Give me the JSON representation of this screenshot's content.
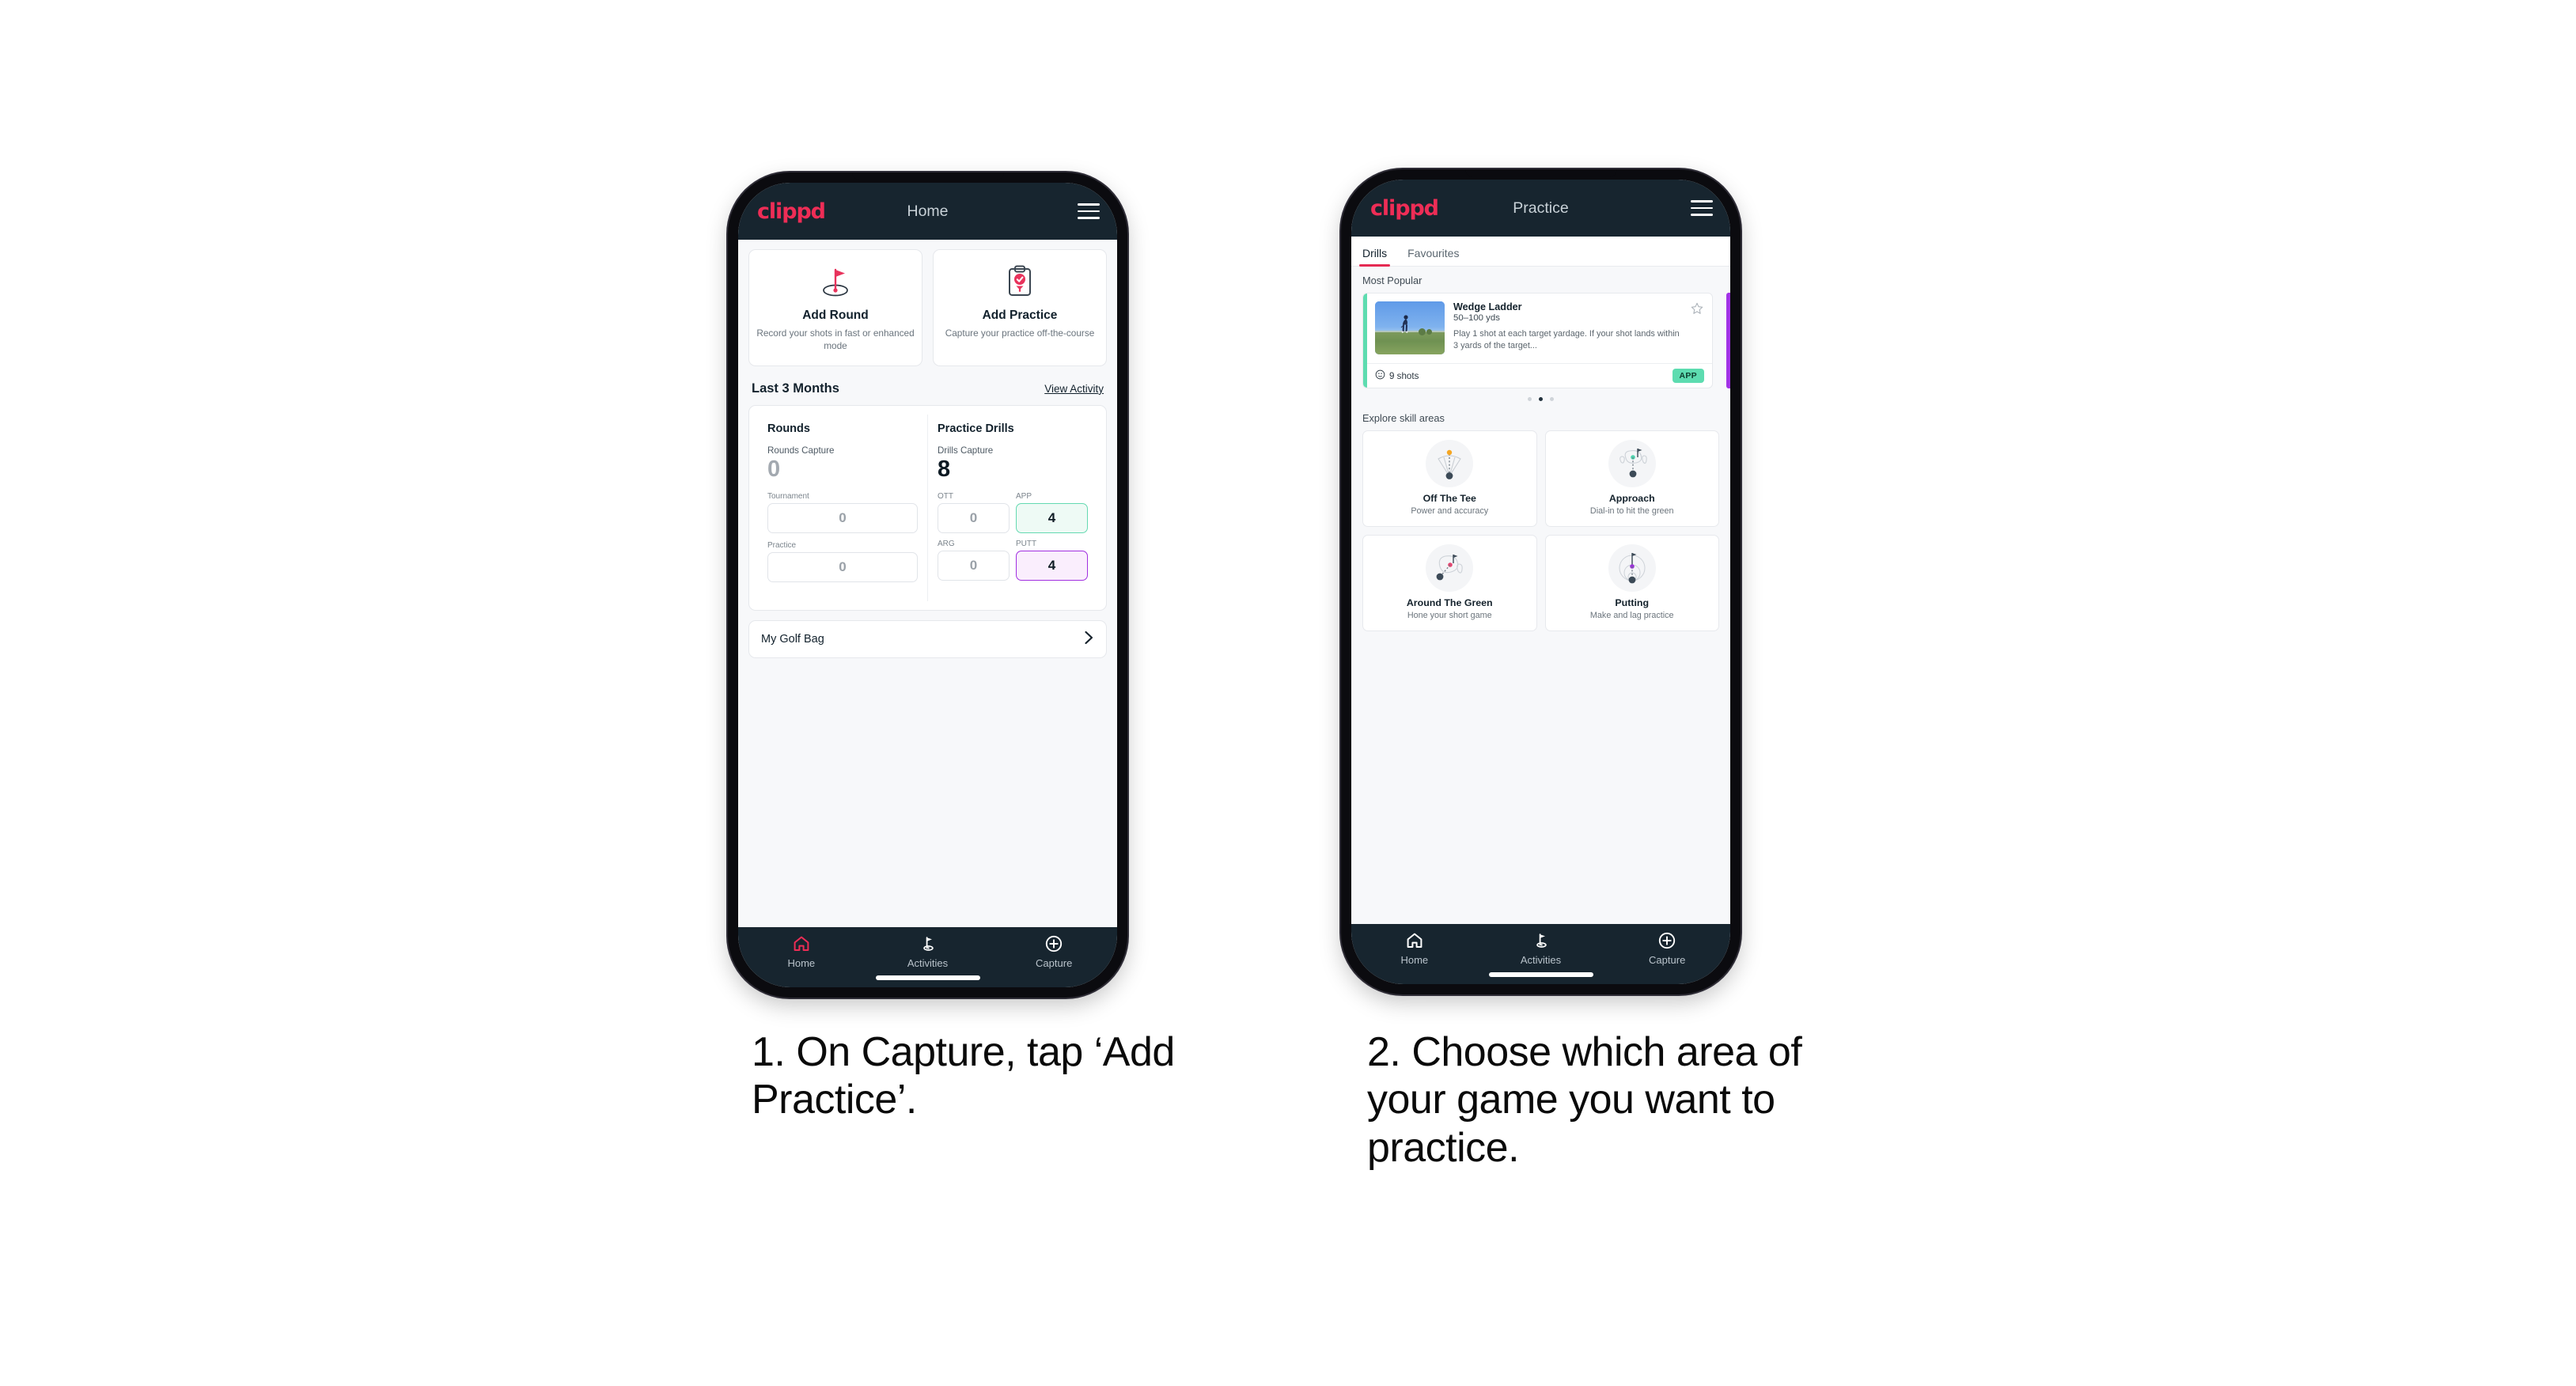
{
  "phone1": {
    "appbar": {
      "brand": "clippd",
      "title": "Home",
      "menu_icon": "hamburger-icon"
    },
    "actions": [
      {
        "icon": "golf-flag-icon",
        "title": "Add Round",
        "subtitle": "Record your shots in fast or enhanced mode"
      },
      {
        "icon": "clipboard-check-icon",
        "title": "Add Practice",
        "subtitle": "Capture your practice off-the-course"
      }
    ],
    "section": {
      "title": "Last 3 Months",
      "link": "View Activity"
    },
    "rounds": {
      "heading": "Rounds",
      "capture_label": "Rounds Capture",
      "capture_value": "0",
      "fields": [
        {
          "label": "Tournament",
          "value": "0",
          "state": "empty"
        },
        {
          "label": "Practice",
          "value": "0",
          "state": "empty"
        }
      ]
    },
    "drills": {
      "heading": "Practice Drills",
      "capture_label": "Drills Capture",
      "capture_value": "8",
      "fields": [
        {
          "label": "OTT",
          "value": "0",
          "state": "empty"
        },
        {
          "label": "APP",
          "value": "4",
          "state": "green"
        },
        {
          "label": "ARG",
          "value": "0",
          "state": "empty"
        },
        {
          "label": "PUTT",
          "value": "4",
          "state": "purple"
        }
      ]
    },
    "bag": {
      "label": "My Golf Bag",
      "icon": "chevron-right-icon"
    },
    "nav": [
      {
        "icon": "home-icon",
        "label": "Home",
        "active": true
      },
      {
        "icon": "golf-flag-icon",
        "label": "Activities",
        "active": false
      },
      {
        "icon": "plus-circle-icon",
        "label": "Capture",
        "active": false
      }
    ]
  },
  "phone2": {
    "appbar": {
      "brand": "clippd",
      "title": "Practice",
      "menu_icon": "hamburger-icon"
    },
    "tabs": [
      {
        "label": "Drills",
        "active": true
      },
      {
        "label": "Favourites",
        "active": false
      }
    ],
    "most_popular_label": "Most Popular",
    "drill_card": {
      "name": "Wedge Ladder",
      "yardage": "50–100 yds",
      "description": "Play 1 shot at each target yardage. If your shot lands within 3 yards of the target...",
      "shots": "9 shots",
      "shots_icon": "clock-icon",
      "badge": "APP",
      "favourite_icon": "star-outline-icon",
      "accent_color": "#5ddcb0",
      "next_card_accent": "#a233e6"
    },
    "carousel_dots": {
      "count": 3,
      "active_index": 1
    },
    "explore_label": "Explore skill areas",
    "skills": [
      {
        "icon": "tee-shot-dispersion-icon",
        "title": "Off The Tee",
        "subtitle": "Power and accuracy",
        "dot_color": "#f5a623"
      },
      {
        "icon": "approach-green-icon",
        "title": "Approach",
        "subtitle": "Dial-in to hit the green",
        "dot_color": "#4fd3ae"
      },
      {
        "icon": "chip-green-icon",
        "title": "Around The Green",
        "subtitle": "Hone your short game",
        "dot_color": "#e8436f"
      },
      {
        "icon": "putting-rings-icon",
        "title": "Putting",
        "subtitle": "Make and lag practice",
        "dot_color": "#9b30d9"
      }
    ],
    "nav": [
      {
        "icon": "home-icon",
        "label": "Home",
        "active": false
      },
      {
        "icon": "golf-flag-icon",
        "label": "Activities",
        "active": false
      },
      {
        "icon": "plus-circle-icon",
        "label": "Capture",
        "active": false
      }
    ]
  },
  "captions": {
    "step1": "1. On Capture, tap ‘Add Practice’.",
    "step2": "2. Choose which area of your game you want to practice."
  },
  "colors": {
    "brand_pink": "#ee2d56",
    "appbar_dark": "#17252f",
    "screen_bg": "#f7f8fa",
    "accent_green": "#5ddcb0",
    "accent_purple": "#a233e6",
    "tab_underline": "#e52a52"
  }
}
